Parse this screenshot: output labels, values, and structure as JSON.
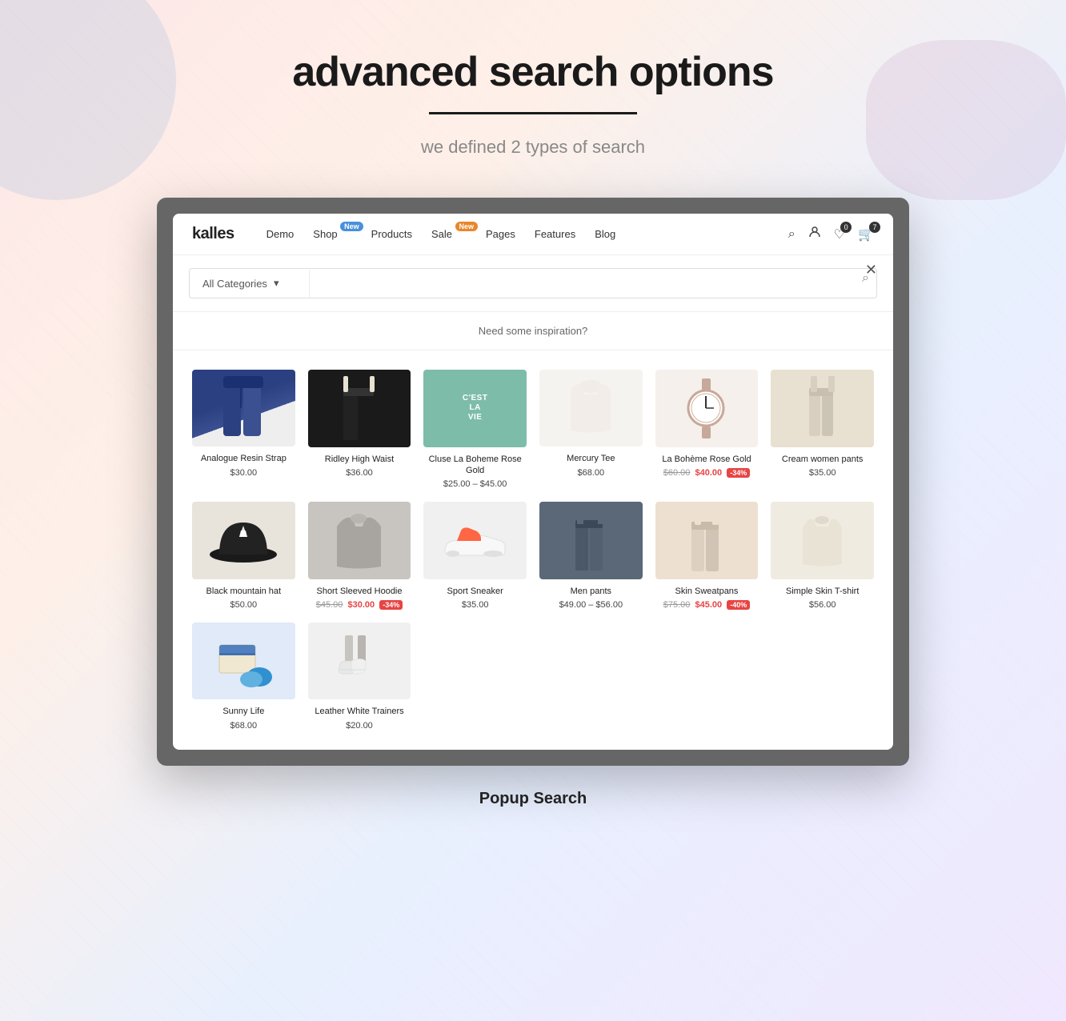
{
  "page": {
    "title": "advanced search  options",
    "underline": true,
    "subtitle": "we defined 2 types of search",
    "popup_label": "Popup Search"
  },
  "nav": {
    "logo": "kalles",
    "items": [
      {
        "label": "Demo",
        "badge": null
      },
      {
        "label": "Shop",
        "badge": {
          "text": "New",
          "color": "blue"
        }
      },
      {
        "label": "Products",
        "badge": null
      },
      {
        "label": "Sale",
        "badge": {
          "text": "New",
          "color": "orange"
        }
      },
      {
        "label": "Pages",
        "badge": null
      },
      {
        "label": "Features",
        "badge": null
      },
      {
        "label": "Blog",
        "badge": null
      }
    ],
    "icons": {
      "search": "⌕",
      "user": "👤",
      "wishlist": "♡",
      "cart": "🛒",
      "cart_count": "7",
      "wishlist_count": "0"
    }
  },
  "search": {
    "category_placeholder": "All Categories",
    "input_placeholder": "",
    "inspiration_text": "Need some inspiration?"
  },
  "products": [
    {
      "name": "Analogue Resin Strap",
      "price": "$30.00",
      "original_price": null,
      "sale_price": null,
      "sale_badge": null,
      "style": "prod-jeans",
      "row": 1
    },
    {
      "name": "Ridley High Waist",
      "price": "$36.00",
      "original_price": null,
      "sale_price": null,
      "sale_badge": null,
      "style": "prod-pants",
      "row": 1
    },
    {
      "name": "Cluse La Boheme Rose Gold",
      "price": null,
      "original_price": "$25.00",
      "sale_price": "$45.00",
      "price_range": "$25.00 – $45.00",
      "sale_badge": null,
      "style": "prod-tshirt",
      "row": 1
    },
    {
      "name": "Mercury Tee",
      "price": "$68.00",
      "original_price": null,
      "sale_price": null,
      "sale_badge": null,
      "style": "prod-white-top",
      "row": 1
    },
    {
      "name": "La Bohème Rose Gold",
      "price": null,
      "original_price": "$60.00",
      "sale_price": "$40.00",
      "sale_badge": "-34%",
      "style": "prod-watch",
      "row": 1
    },
    {
      "name": "Cream women pants",
      "price": "$35.00",
      "original_price": null,
      "sale_price": null,
      "sale_badge": null,
      "style": "prod-cream-pants",
      "row": 1
    },
    {
      "name": "Black mountain hat",
      "price": "$50.00",
      "original_price": null,
      "sale_price": null,
      "sale_badge": null,
      "style": "prod-hat",
      "row": 1
    },
    {
      "name": "Short Sleeved Hoodie",
      "price": null,
      "original_price": "$45.00",
      "sale_price": "$30.00",
      "sale_badge": "-34%",
      "style": "prod-hoodie",
      "row": 2
    },
    {
      "name": "Sport Sneaker",
      "price": "$35.00",
      "original_price": null,
      "sale_price": null,
      "sale_badge": null,
      "style": "prod-sneaker",
      "row": 2
    },
    {
      "name": "Men pants",
      "price": null,
      "original_price": "$49.00",
      "sale_price": "$56.00",
      "price_range": "$49.00 – $56.00",
      "sale_badge": null,
      "style": "prod-men-pants",
      "row": 2
    },
    {
      "name": "Skin Sweatpans",
      "price": null,
      "original_price": "$75.00",
      "sale_price": "$45.00",
      "sale_badge": "-40%",
      "style": "prod-skin-pants",
      "row": 2
    },
    {
      "name": "Simple Skin T-shirt",
      "price": "$56.00",
      "original_price": null,
      "sale_price": null,
      "sale_badge": null,
      "style": "prod-tshirt-plain",
      "row": 2
    },
    {
      "name": "Sunny Life",
      "price": "$68.00",
      "original_price": null,
      "sale_price": null,
      "sale_badge": null,
      "style": "prod-sunny",
      "row": 2
    },
    {
      "name": "Leather White Trainers",
      "price": "$20.00",
      "original_price": null,
      "sale_price": null,
      "sale_badge": null,
      "style": "prod-trainers",
      "row": 2
    }
  ]
}
